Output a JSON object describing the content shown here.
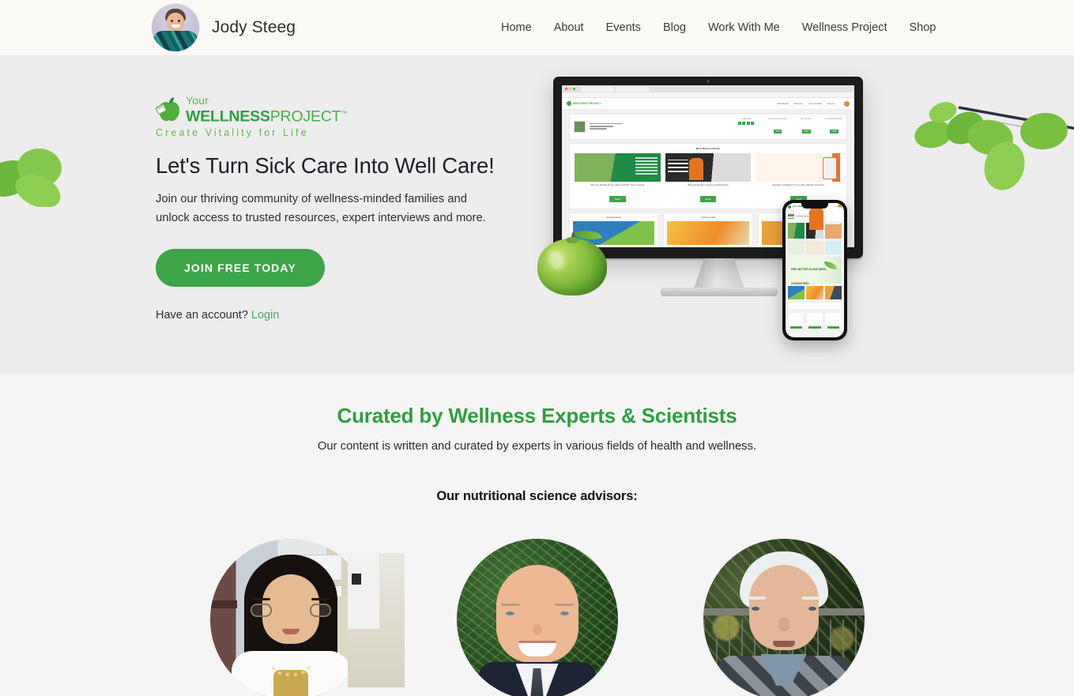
{
  "header": {
    "brand_name": "Jody Steeg",
    "avatar_alt": "jody-steeg-avatar",
    "nav": [
      {
        "label": "Home"
      },
      {
        "label": "About"
      },
      {
        "label": "Events"
      },
      {
        "label": "Blog"
      },
      {
        "label": "Work With Me"
      },
      {
        "label": "Wellness Project"
      },
      {
        "label": "Shop"
      }
    ]
  },
  "hero": {
    "logo": {
      "word_your": "Your",
      "word_wellness": "WELLNESS",
      "word_project": "PROJECT",
      "trademark": "™",
      "tagline": "Create Vitality for Life"
    },
    "heading": "Let's Turn Sick Care Into Well Care!",
    "subheading": "Join our thriving community of wellness-minded families and unlock access to trusted resources, expert interviews and more.",
    "cta_label": "JOIN FREE TODAY",
    "account_prompt": "Have an account?",
    "login_label": "Login",
    "device": {
      "app_logo_text": "WELLNESS PROJECT",
      "app_menu": [
        "Dashboard",
        "Discover",
        "Learn & Earn",
        "Events"
      ],
      "profile_title": "Your Wellness Guide",
      "profile_name": "Anne Thomas",
      "stats": [
        {
          "caption": "Follow Me"
        },
        {
          "caption": "My Facebook Group",
          "badge": "JOIN"
        },
        {
          "caption": "My Tool Kit",
          "badge": "VIEW"
        },
        {
          "caption": "My Wellness Shop",
          "badge": "VIEW"
        }
      ],
      "recent_title": "Most Recent Articles",
      "articles": [
        {
          "caption": "What Are Shaklee Energy Chews and Why They're Special",
          "button": "Read"
        },
        {
          "caption": "What Should Men Look for in a Multivitamin?",
          "button": "Read"
        },
        {
          "caption": "Benefits of CitriBoost if You've Had a Bariatric Procedure",
          "button": "Read"
        }
      ],
      "sub_cards": [
        {
          "title": "July Newsletter"
        },
        {
          "title": "Archived Calls"
        },
        {
          "title": "Recipes"
        }
      ],
      "phone_banner": "FEEL BETTER IN ONE WEEK. GUARANTEED."
    }
  },
  "experts": {
    "heading": "Curated by Wellness Experts & Scientists",
    "lead": "Our content is written and curated by experts in various fields of health and wellness.",
    "subheading": "Our nutritional science advisors:",
    "advisors": [
      {
        "alt": "advisor-photo-1"
      },
      {
        "alt": "advisor-photo-2"
      },
      {
        "alt": "advisor-photo-3"
      }
    ]
  },
  "colors": {
    "brand_green": "#3da548",
    "heading_green": "#2f9e41",
    "link_green": "#4ca860",
    "header_bg": "#faf9f6",
    "hero_bg": "#ededed",
    "section_bg": "#f5f5f5"
  }
}
